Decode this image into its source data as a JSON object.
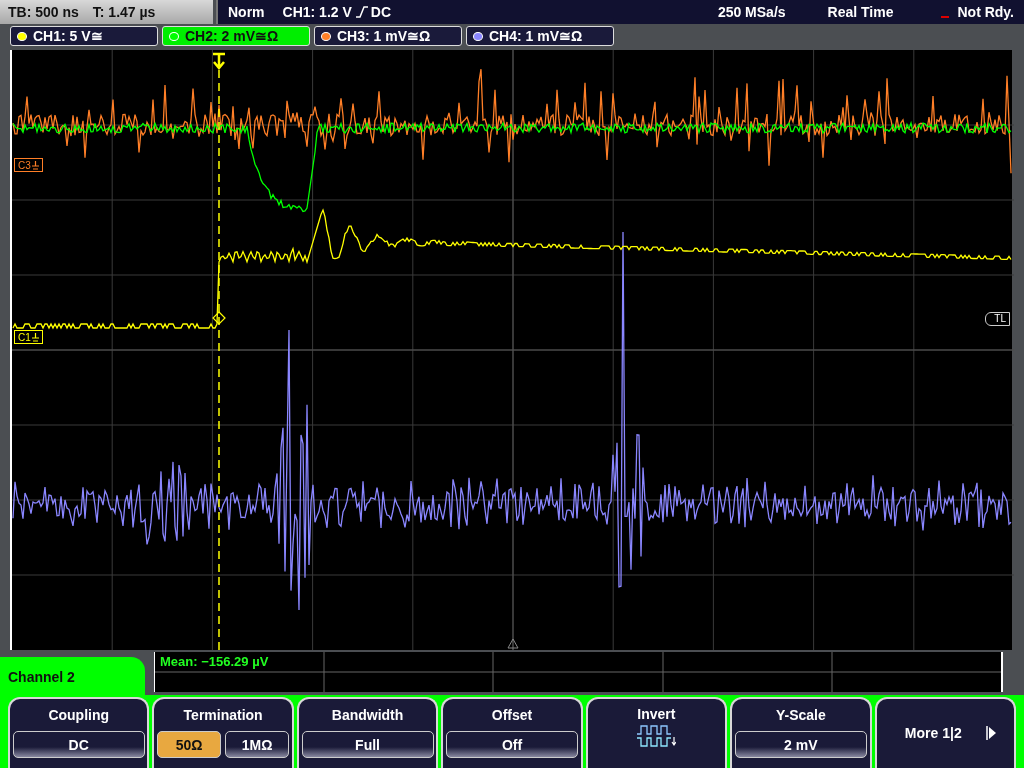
{
  "top_bar": {
    "timebase": "TB: 500 ns",
    "trigger_time": "T: 1.47 µs",
    "mode": "Norm",
    "trigger_level": "CH1: 1.2 V",
    "trigger_coupling": "DC",
    "sample_rate": "250 MSa/s",
    "acquisition": "Real Time",
    "status": "Not Rdy."
  },
  "channels": [
    {
      "label": "CH1: 5 V≅",
      "color": "#ffff00",
      "selected": false
    },
    {
      "label": "CH2: 2 mV≅Ω",
      "color": "#00ff00",
      "selected": true
    },
    {
      "label": "CH3: 1 mV≅Ω",
      "color": "#ff7f27",
      "selected": false
    },
    {
      "label": "CH4: 1 mV≅Ω",
      "color": "#8a86ff",
      "selected": false
    }
  ],
  "markers": [
    {
      "label": "C3",
      "color": "#ff7f27"
    },
    {
      "label": "C1",
      "color": "#ffff00"
    }
  ],
  "trigger_level_marker": {
    "label": "TL"
  },
  "measurement": {
    "text": "Mean: −156.29 µV"
  },
  "menu": {
    "title": "Channel 2",
    "softkeys": [
      {
        "kind": "option",
        "label": "Coupling",
        "value": "DC"
      },
      {
        "kind": "choice",
        "label": "Termination",
        "options": [
          {
            "label": "50Ω",
            "selected": true
          },
          {
            "label": "1MΩ",
            "selected": false
          }
        ]
      },
      {
        "kind": "option",
        "label": "Bandwidth",
        "value": "Full"
      },
      {
        "kind": "option",
        "label": "Offset",
        "value": "Off"
      },
      {
        "kind": "icon",
        "label": "Invert"
      },
      {
        "kind": "option",
        "label": "Y-Scale",
        "value": "2 mV"
      },
      {
        "kind": "more",
        "label": "More 1|2"
      }
    ]
  }
}
